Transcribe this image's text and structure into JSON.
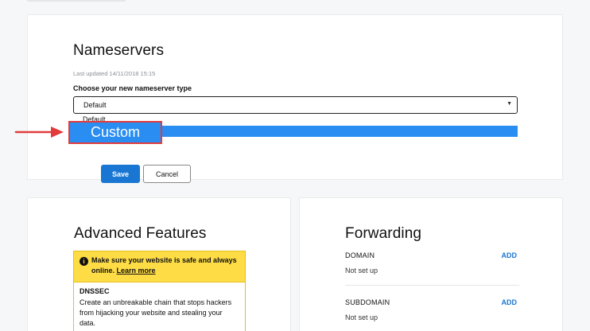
{
  "nameservers": {
    "title": "Nameservers",
    "last_updated": "Last updated 14/11/2018 15:15",
    "choose_label": "Choose your new nameserver type",
    "select_value": "Default",
    "options": [
      "Default",
      "Custom"
    ],
    "highlighted_option": "Custom",
    "save_label": "Save",
    "cancel_label": "Cancel"
  },
  "advanced": {
    "title": "Advanced Features",
    "notice_text": "Make sure your website is safe and always online.",
    "notice_link": "Learn more",
    "dnssec_title": "DNSSEC",
    "dnssec_desc": "Create an unbreakable chain that stops hackers from hijacking your website and stealing your data."
  },
  "forwarding": {
    "title": "Forwarding",
    "rows": [
      {
        "label": "DOMAIN",
        "value": "Not set up",
        "action": "ADD"
      },
      {
        "label": "SUBDOMAIN",
        "value": "Not set up",
        "action": "ADD"
      }
    ]
  },
  "colors": {
    "primary": "#1976d2",
    "dropdown_highlight": "#2a8df2",
    "annotation_red": "#e23b3b",
    "notice_yellow": "#fedc45"
  }
}
